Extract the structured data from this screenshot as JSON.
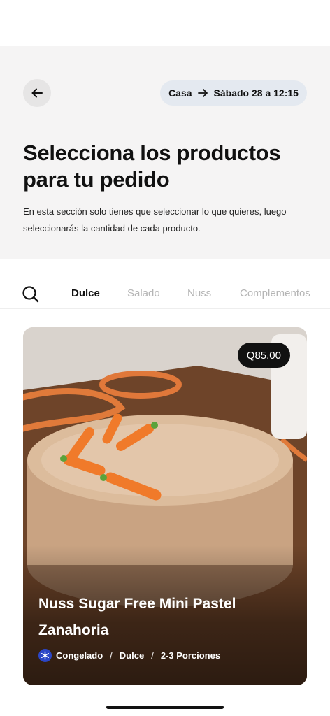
{
  "header": {
    "back_icon": "arrow-left-icon",
    "route": {
      "origin": "Casa",
      "arrow_icon": "arrow-right-icon",
      "destination": "Sábado 28 a 12:15"
    },
    "title": "Selecciona los productos para tu pedido",
    "subtitle": "En esta sección solo tienes que seleccionar lo que quieres, luego seleccionarás la cantidad de cada producto."
  },
  "tabs": {
    "search_icon": "search-icon",
    "items": [
      {
        "label": "Dulce",
        "active": true
      },
      {
        "label": "Salado",
        "active": false
      },
      {
        "label": "Nuss",
        "active": false
      },
      {
        "label": "Complementos",
        "active": false
      }
    ]
  },
  "product": {
    "price": "Q85.00",
    "name": "Nuss Sugar Free Mini Pastel Zanahoria",
    "storage_icon": "snowflake-icon",
    "storage": "Congelado",
    "separator": "/",
    "category": "Dulce",
    "portions": "2-3 Porciones"
  },
  "colors": {
    "panel_bg": "#f5f4f4",
    "pill_bg": "#e4e9f0",
    "badge_bg": "#111111",
    "snow_badge": "#2b46c7"
  }
}
